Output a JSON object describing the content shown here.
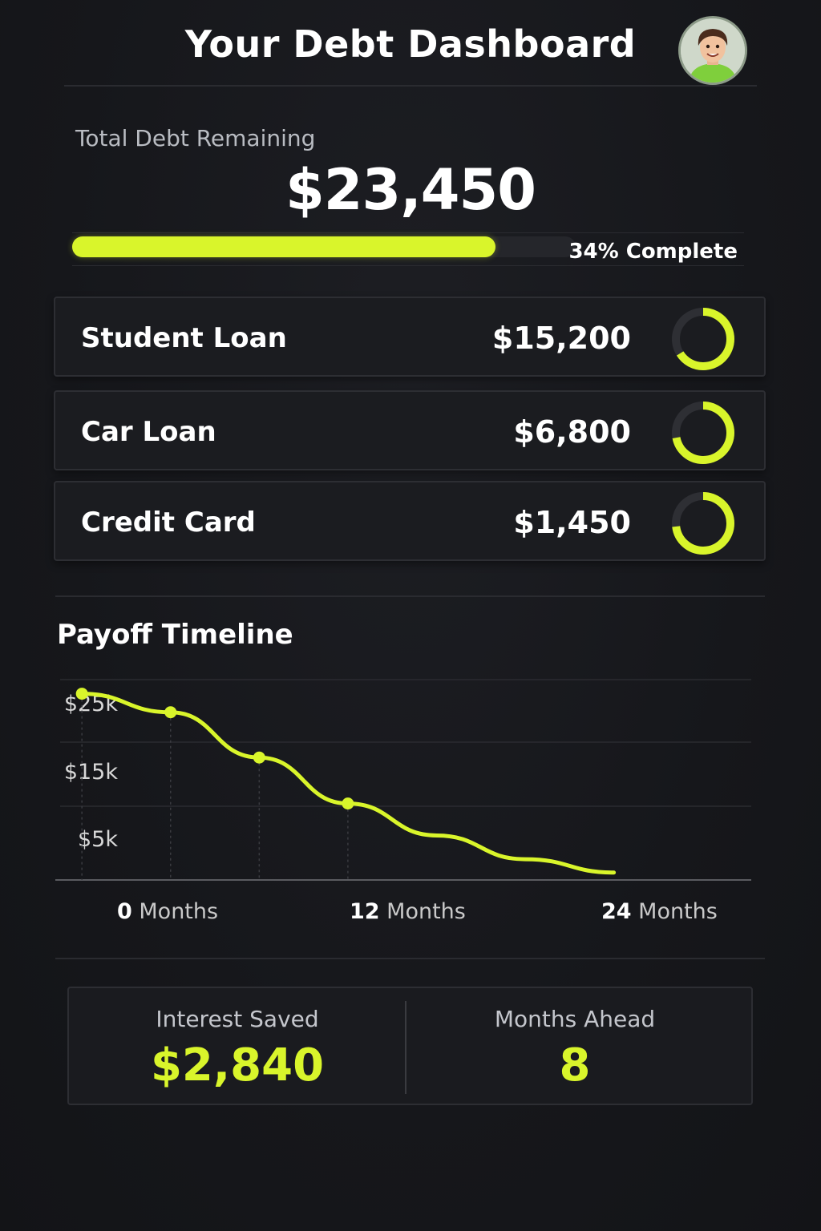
{
  "header": {
    "title": "Your Debt Dashboard"
  },
  "summary": {
    "total_label": "Total Debt Remaining",
    "total_amount": "$23,450",
    "progress_fraction": 0.84,
    "progress_text": "34% Complete"
  },
  "debts": [
    {
      "name": "Student Loan",
      "amount": "$15,200",
      "ring_fraction": 0.66
    },
    {
      "name": "Car Loan",
      "amount": "$6,800",
      "ring_fraction": 0.72
    },
    {
      "name": "Credit Card",
      "amount": "$1,450",
      "ring_fraction": 0.73
    }
  ],
  "timeline": {
    "title": "Payoff Timeline"
  },
  "chart_data": {
    "type": "line",
    "title": "Payoff Timeline",
    "y_ticks": [
      "$25k",
      "$15k",
      "$5k"
    ],
    "x_ticks": [
      {
        "num": "0",
        "unit": " Months"
      },
      {
        "num": "12",
        "unit": " Months"
      },
      {
        "num": "24",
        "unit": " Months"
      }
    ],
    "series": [
      {
        "x": [
          0,
          4,
          8,
          12,
          16,
          20,
          24
        ],
        "y": [
          25.1,
          22.6,
          16.5,
          10.3,
          6.0,
          2.8,
          1.0
        ]
      }
    ],
    "marked_points": [
      0,
      1,
      2,
      3
    ],
    "ylim": [
      0,
      27
    ],
    "xlim": [
      -1.2,
      30.2
    ],
    "grid": true,
    "line_color": "#d9f52b"
  },
  "stats": {
    "interest_label": "Interest Saved",
    "interest_value": "$2,840",
    "months_label": "Months Ahead",
    "months_value": "8"
  },
  "colors": {
    "accent": "#d9f52b",
    "background": "#16171b",
    "card": "#1b1c20"
  }
}
